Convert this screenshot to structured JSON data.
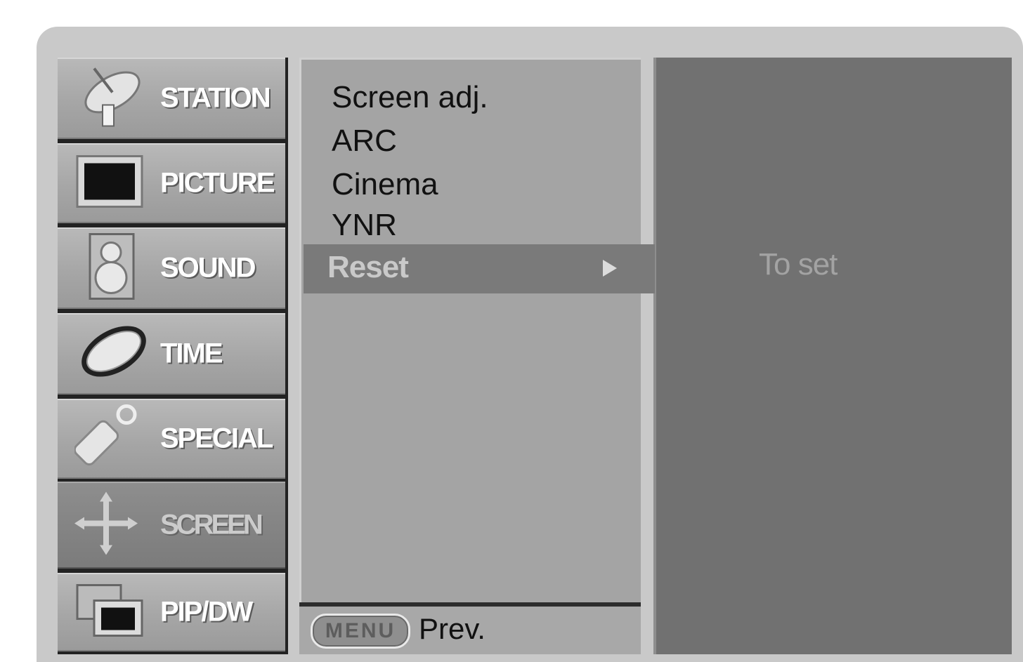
{
  "sidebar": {
    "items": [
      {
        "label": "STATION",
        "icon": "satellite-dish-icon"
      },
      {
        "label": "PICTURE",
        "icon": "tv-screen-icon"
      },
      {
        "label": "SOUND",
        "icon": "speaker-icon"
      },
      {
        "label": "TIME",
        "icon": "clock-icon"
      },
      {
        "label": "SPECIAL",
        "icon": "key-tag-icon"
      },
      {
        "label": "SCREEN",
        "icon": "move-arrows-icon"
      },
      {
        "label": "PIP/DW",
        "icon": "pip-windows-icon"
      }
    ],
    "active": "SCREEN"
  },
  "submenu": {
    "items": [
      "Screen adj.",
      "ARC",
      "Cinema",
      "YNR"
    ],
    "selected": {
      "label": "Reset",
      "icon": "right-arrow-icon"
    }
  },
  "info_panel": {
    "text": "To set"
  },
  "footer": {
    "button_label": "MENU",
    "label": "Prev."
  },
  "colors": {
    "panel": "#c9c9c9",
    "menu_bg": "#a4a4a4",
    "highlight": "#7a7a7a",
    "info_bg": "#717171"
  }
}
